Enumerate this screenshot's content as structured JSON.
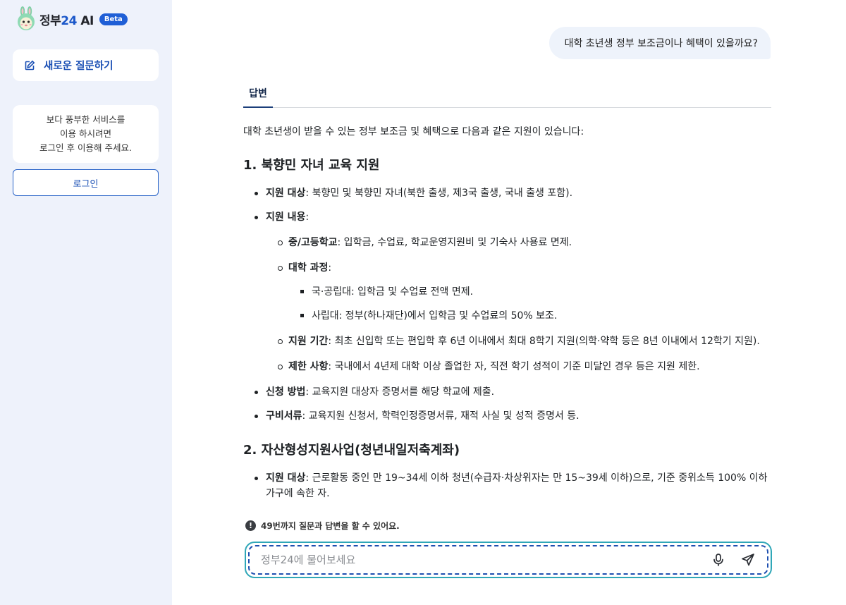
{
  "sidebar": {
    "brand": {
      "name": "정부",
      "number": "24",
      "ai": "AI",
      "badge": "Beta"
    },
    "new_question_label": "새로운 질문하기",
    "login_notice": [
      "보다 풍부한 서비스를",
      "이용 하시려면",
      "로그인 후 이용해 주세요."
    ],
    "login_label": "로그인"
  },
  "chat": {
    "user_message": "대학 초년생 정부 보조금이나 혜택이 있을까요?",
    "tab_label": "답변",
    "intro": "대학 초년생이 받을 수 있는 정부 보조금 및 혜택으로 다음과 같은 지원이 있습니다:",
    "sections": [
      {
        "heading": "1. 북향민 자녀 교육 지원",
        "items": [
          {
            "label": "지원 대상",
            "text": ": 북향민 및 북향민 자녀(북한 출생, 제3국 출생, 국내 출생 포함)."
          },
          {
            "label": "지원 내용",
            "text": ":"
          },
          {
            "label": "신청 방법",
            "text": ": 교육지원 대상자 증명서를 해당 학교에 제출."
          },
          {
            "label": "구비서류",
            "text": ": 교육지원 신청서, 학력인정증명서류, 재적 사실 및 성적 증명서 등."
          }
        ],
        "sub_items": [
          {
            "label": "중/고등학교",
            "text": ": 입학금, 수업료, 학교운영지원비 및 기숙사 사용료 면제."
          },
          {
            "label": "대학 과정",
            "text": ":"
          },
          {
            "label": "지원 기간",
            "text": ": 최초 신입학 또는 편입학 후 6년 이내에서 최대 8학기 지원(의학·약학 등은 8년 이내에서 12학기 지원)."
          },
          {
            "label": "제한 사항",
            "text": ": 국내에서 4년제 대학 이상 졸업한 자, 직전 학기 성적이 기준 미달인 경우 등은 지원 제한."
          }
        ],
        "sub_sub_items": [
          "국·공립대: 입학금 및 수업료 전액 면제.",
          "사립대: 정부(하나재단)에서 입학금 및 수업료의 50% 보조."
        ]
      },
      {
        "heading": "2. 자산형성지원사업(청년내일저축계좌)",
        "items": [
          {
            "label": "지원 대상",
            "text": ": 근로활동 중인 만 19~34세 이하 청년(수급자·차상위자는 만 15~39세 이하)으로, 기준 중위소득 100% 이하 가구에 속한 자."
          }
        ]
      }
    ],
    "limit_notice": "49번까지 질문과 답변을 할 수 있어요.",
    "input_placeholder": "정부24에 물어보세요"
  },
  "colors": {
    "sidebar_bg": "#eef2fb",
    "brand_blue": "#1f5fd6",
    "input_border": "#2fa7b8"
  },
  "icons": [
    "rabbit-mascot-icon",
    "edit-icon",
    "alert-icon",
    "microphone-icon",
    "send-icon"
  ]
}
